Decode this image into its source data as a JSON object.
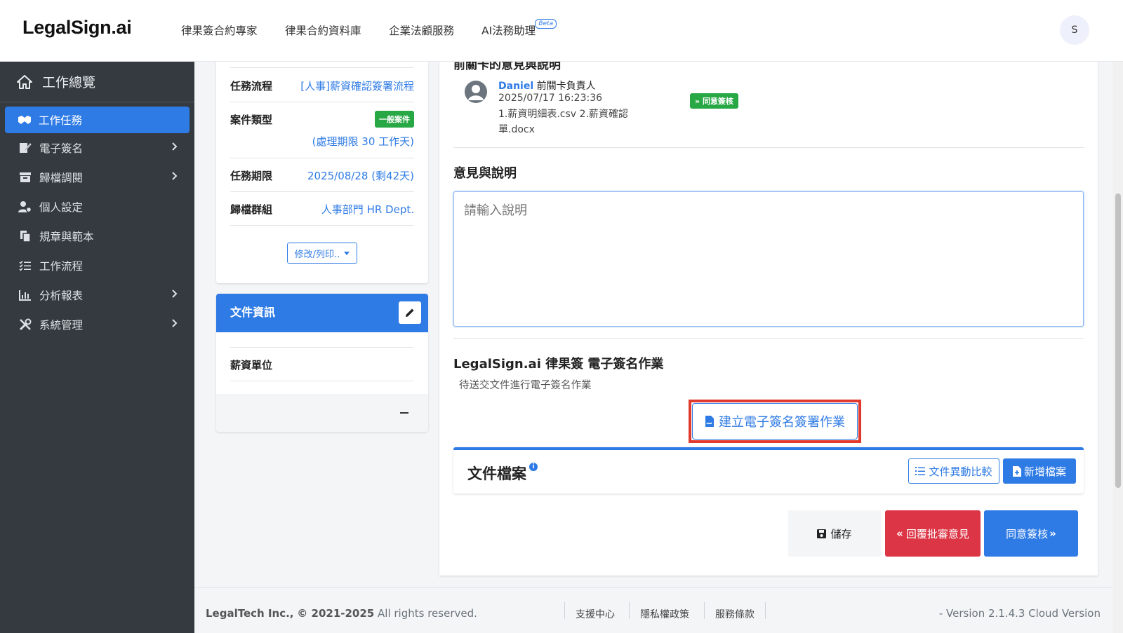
{
  "app": {
    "logo": "LegalSign.ai",
    "avatar_initial": "S"
  },
  "nav": {
    "items": [
      "律果簽合約專家",
      "律果合約資料庫",
      "企業法顧服務",
      "AI法務助理"
    ],
    "beta": "Beta"
  },
  "sidebar": {
    "home": "工作總覽",
    "items": [
      {
        "label": "工作任務",
        "icon": "handshake-icon",
        "active": true
      },
      {
        "label": "電子簽名",
        "icon": "signature-icon"
      },
      {
        "label": "歸檔調閱",
        "icon": "archive-icon"
      },
      {
        "label": "個人設定",
        "icon": "user-gear-icon"
      },
      {
        "label": "規章與範本",
        "icon": "copy-icon"
      },
      {
        "label": "工作流程",
        "icon": "list-check-icon"
      },
      {
        "label": "分析報表",
        "icon": "chart-icon"
      },
      {
        "label": "系統管理",
        "icon": "tools-icon"
      }
    ]
  },
  "task_info": {
    "flow_label": "任務流程",
    "flow_value": "[人事]薪資確認簽署流程",
    "type_label": "案件類型",
    "type_badge": "一般案件",
    "type_deadline": "(處理期限 30 工作天)",
    "due_label": "任務期限",
    "due_value": "2025/08/28 (剩42天)",
    "group_label": "歸檔群組",
    "group_value": "人事部門 HR Dept.",
    "dropdown": "修改/列印.."
  },
  "doc_info": {
    "title": "文件資訊",
    "field_label": "薪資單位"
  },
  "main": {
    "prev_section_title": "前關卡的意見與說明",
    "prev": {
      "name": "Daniel",
      "role": "前關卡負責人",
      "time": "2025/07/17 16:23:36",
      "files": "1.薪資明細表.csv 2.薪資確認單.docx",
      "badge": "同意簽核"
    },
    "opinion_title": "意見與說明",
    "opinion_placeholder": "請輸入說明",
    "esign_title": "LegalSign.ai 律果簽 電子簽名作業",
    "esign_sub": "待送交文件進行電子簽名作業",
    "create_btn": "建立電子簽名簽署作業",
    "files_title": "文件檔案",
    "compare_btn": "文件異動比較",
    "add_btn": "新增檔案",
    "save_btn": "儲存",
    "reject_btn": "回覆批審意見",
    "agree_btn": "同意簽核"
  },
  "footer": {
    "company": "LegalTech Inc.,",
    "copyright": "© 2021-2025",
    "rights": "All rights reserved.",
    "links": [
      "支援中心",
      "隱私權政策",
      "服務條款"
    ],
    "version": "- Version 2.1.4.3 Cloud Version"
  },
  "colors": {
    "primary": "#2f7be5",
    "success": "#28a745",
    "danger": "#dc3545",
    "sidebar": "#343a40"
  }
}
